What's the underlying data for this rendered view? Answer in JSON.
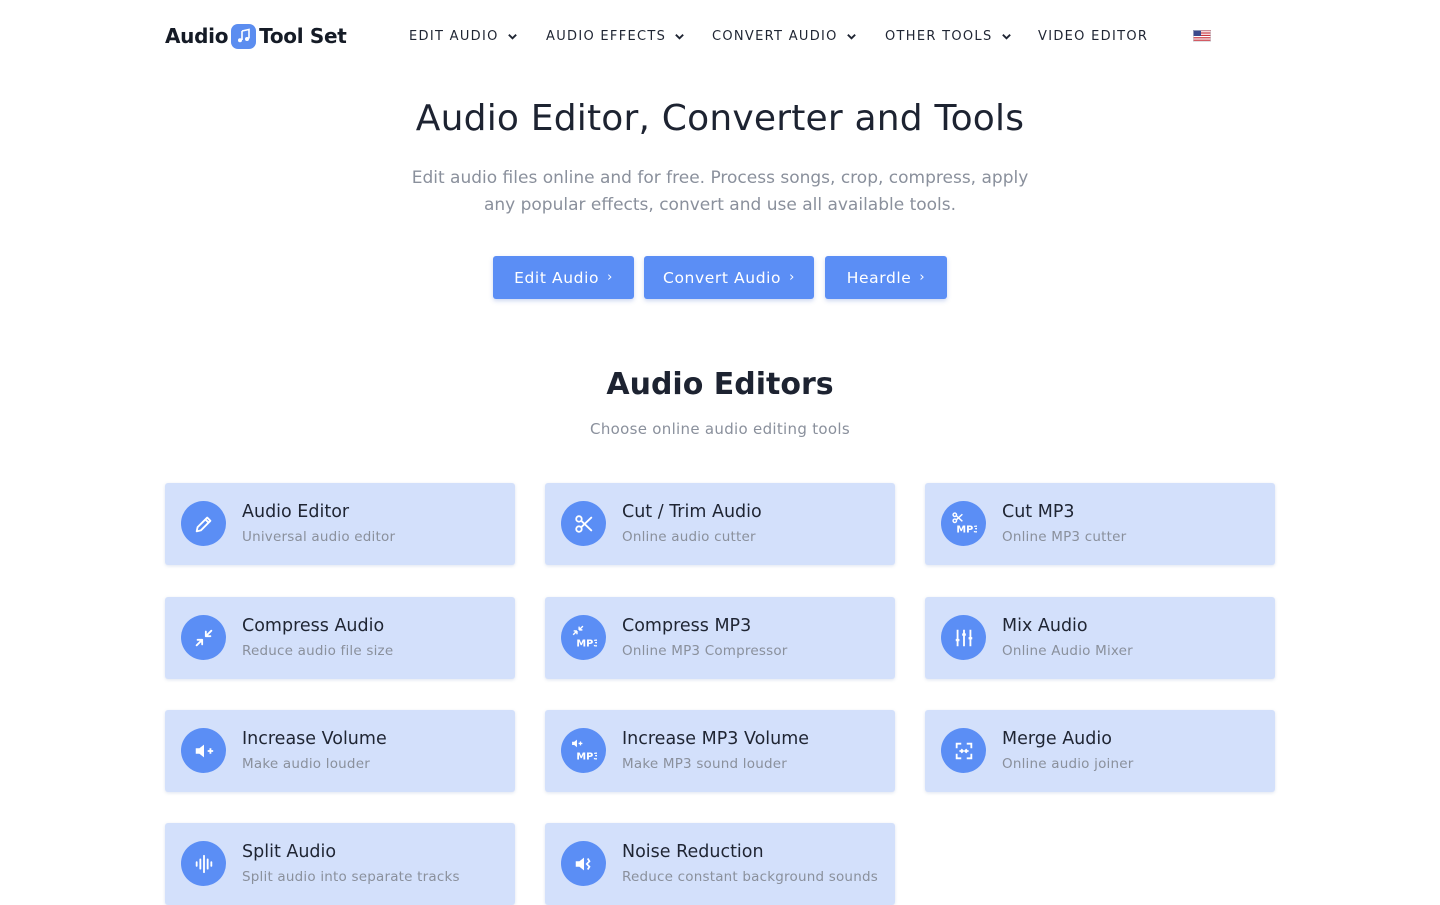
{
  "brand": {
    "part1": "Audio",
    "part2": "Tool Set"
  },
  "nav": {
    "items": [
      {
        "label": "EDIT AUDIO",
        "has_dropdown": true
      },
      {
        "label": "AUDIO EFFECTS",
        "has_dropdown": true
      },
      {
        "label": "CONVERT AUDIO",
        "has_dropdown": true
      },
      {
        "label": "OTHER TOOLS",
        "has_dropdown": true
      },
      {
        "label": "VIDEO EDITOR",
        "has_dropdown": false
      }
    ],
    "language_icon": "us-flag-icon"
  },
  "hero": {
    "title": "Audio Editor, Converter and Tools",
    "subtitle": "Edit audio files online and for free. Process songs, crop, compress, apply any popular effects, convert and use all available tools.",
    "buttons": [
      {
        "label": "Edit Audio",
        "icon": "chevron-right-icon"
      },
      {
        "label": "Convert Audio",
        "icon": "chevron-right-icon"
      },
      {
        "label": "Heardle",
        "icon": "chevron-right-icon"
      }
    ]
  },
  "section": {
    "title": "Audio Editors",
    "subtitle": "Choose online audio editing tools",
    "cards": [
      {
        "title": "Audio Editor",
        "subtitle": "Universal audio editor",
        "icon": "pencil-icon"
      },
      {
        "title": "Cut / Trim Audio",
        "subtitle": "Online audio cutter",
        "icon": "scissors-icon"
      },
      {
        "title": "Cut MP3",
        "subtitle": "Online MP3 cutter",
        "icon": "scissors-mp3-icon",
        "icon_text": "MP3"
      },
      {
        "title": "Compress Audio",
        "subtitle": "Reduce audio file size",
        "icon": "compress-icon"
      },
      {
        "title": "Compress MP3",
        "subtitle": "Online MP3 Compressor",
        "icon": "compress-mp3-icon",
        "icon_text": "MP3"
      },
      {
        "title": "Mix Audio",
        "subtitle": "Online Audio Mixer",
        "icon": "sliders-icon"
      },
      {
        "title": "Increase Volume",
        "subtitle": "Make audio louder",
        "icon": "volume-plus-icon"
      },
      {
        "title": "Increase MP3 Volume",
        "subtitle": "Make MP3 sound louder",
        "icon": "volume-plus-mp3-icon",
        "icon_text": "MP3"
      },
      {
        "title": "Merge Audio",
        "subtitle": "Online audio joiner",
        "icon": "merge-icon"
      },
      {
        "title": "Split Audio",
        "subtitle": "Split audio into separate tracks",
        "icon": "split-waveform-icon"
      },
      {
        "title": "Noise Reduction",
        "subtitle": "Reduce constant background sounds",
        "icon": "noise-reduction-icon"
      }
    ]
  },
  "colors": {
    "accent": "#5b8ef5",
    "card_bg": "#d3e0fb",
    "text_dark": "#1f2533",
    "text_muted": "#8a909c"
  }
}
